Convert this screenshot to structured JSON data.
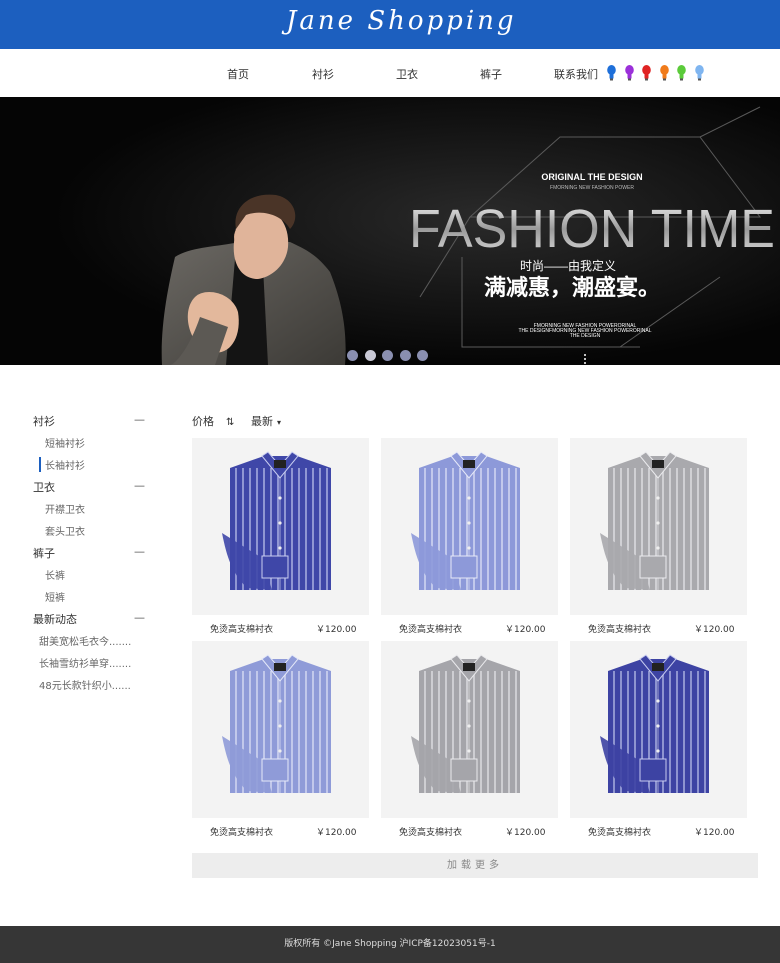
{
  "header": {
    "logo": "Jane Shopping"
  },
  "nav": {
    "items": [
      "首页",
      "衬衫",
      "卫衣",
      "裤子",
      "联系我们"
    ],
    "bulb_colors": [
      "#1e6fd9",
      "#9b30d9",
      "#e02424",
      "#f07b1b",
      "#5bcb3a",
      "#7fb5f0"
    ]
  },
  "banner": {
    "tagline": "ORIGINAL THE DESIGN",
    "tagline_sub": "FMORNING NEW FASHION POWER",
    "headline": "FASHION TIME",
    "slogan_small": "时尚——由我定义",
    "slogan_big": "满减惠，潮盛宴。",
    "fine_print": [
      "FMORNING NEW FASHION POWERORINAL",
      "THE DESIGNFMORNING NEW FASHION POWERORINAL",
      "THE DESIGN"
    ],
    "slide_count": 5,
    "active_slide": 2
  },
  "sidebar": {
    "categories": [
      {
        "label": "衬衫",
        "items": [
          "短袖衬衫",
          "长袖衬衫"
        ]
      },
      {
        "label": "卫衣",
        "items": [
          "开襟卫衣",
          "套头卫衣"
        ]
      },
      {
        "label": "裤子",
        "items": [
          "长裤",
          "短裤"
        ]
      },
      {
        "label": "最新动态",
        "items": [
          "甜美宽松毛衣今.......",
          "长袖雪纺衫单穿.......",
          "48元长款针织小......"
        ]
      }
    ],
    "collapse_symbol": "—"
  },
  "sort": {
    "price": "价格",
    "price_icon": "⇅",
    "latest": "最新",
    "latest_icon": "▾"
  },
  "products": [
    {
      "name": "免烫高支棉衬衣",
      "price": "￥120.00",
      "shirt_color": "#3f47a8",
      "stripe": "#c8cdf0"
    },
    {
      "name": "免烫高支棉衬衣",
      "price": "￥120.00",
      "shirt_color": "#8d99d9",
      "stripe": "#e6e9f8"
    },
    {
      "name": "免烫高支棉衬衣",
      "price": "￥120.00",
      "shirt_color": "#a9a9ad",
      "stripe": "#ebebee"
    },
    {
      "name": "免烫高支棉衬衣",
      "price": "￥120.00",
      "shirt_color": "#8f9bd8",
      "stripe": "#e4e8f8"
    },
    {
      "name": "免烫高支棉衬衣",
      "price": "￥120.00",
      "shirt_color": "#a5a5aa",
      "stripe": "#e9e9ec"
    },
    {
      "name": "免烫高支棉衬衣",
      "price": "￥120.00",
      "shirt_color": "#3d43a3",
      "stripe": "#c6caef"
    }
  ],
  "load_more": "加载更多",
  "footer": {
    "text": "版权所有 ©Jane Shopping 沪ICP备12023051号-1"
  }
}
